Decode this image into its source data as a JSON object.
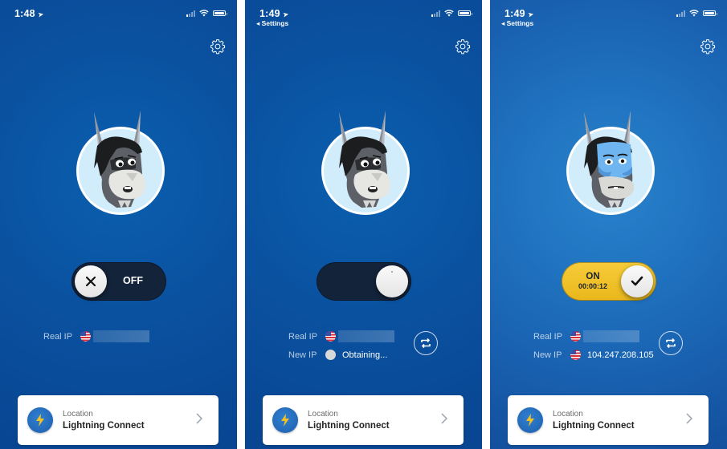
{
  "colors": {
    "background_disconnected": "#0a52a0",
    "background_connected": "#1f72bf",
    "toggle_off": "#13233a",
    "toggle_on": "#f0c22a",
    "avatar_circle": "#d1ecfb",
    "location_icon_bg": "#1f5fae",
    "bolt": "#f5c020"
  },
  "screens": [
    {
      "state": "disconnected",
      "status_bar": {
        "time": "1:48",
        "back_label": null
      },
      "settings_icon": "gear-icon",
      "avatar": "donkey-worried",
      "toggle": {
        "state": "off",
        "label": "OFF",
        "knob_icon": "close-icon"
      },
      "ip": {
        "real_ip_label": "Real IP",
        "real_ip_flag": "us-flag-icon",
        "real_ip_value": "(redacted)"
      },
      "location": {
        "label": "Location",
        "value": "Lightning Connect",
        "icon": "lightning-icon"
      }
    },
    {
      "state": "connecting",
      "status_bar": {
        "time": "1:49",
        "back_label": "Settings"
      },
      "settings_icon": "gear-icon",
      "avatar": "donkey-worried",
      "toggle": {
        "state": "connecting",
        "label": "",
        "knob_icon": "spinner-icon"
      },
      "ip": {
        "real_ip_label": "Real IP",
        "real_ip_flag": "us-flag-icon",
        "real_ip_value": "(redacted)",
        "new_ip_label": "New IP",
        "new_ip_flag": "unknown-flag-icon",
        "new_ip_value": "Obtaining..."
      },
      "refresh_icon": "change-ip-icon",
      "location": {
        "label": "Location",
        "value": "Lightning Connect",
        "icon": "lightning-icon"
      }
    },
    {
      "state": "connected",
      "status_bar": {
        "time": "1:49",
        "back_label": "Settings"
      },
      "settings_icon": "gear-icon",
      "avatar": "donkey-masked",
      "toggle": {
        "state": "on",
        "label": "ON",
        "timer": "00:00:12",
        "knob_icon": "check-icon"
      },
      "ip": {
        "real_ip_label": "Real IP",
        "real_ip_flag": "us-flag-icon",
        "real_ip_value": "(redacted)",
        "new_ip_label": "New IP",
        "new_ip_flag": "us-flag-icon",
        "new_ip_value": "104.247.208.105"
      },
      "refresh_icon": "change-ip-icon",
      "location": {
        "label": "Location",
        "value": "Lightning Connect",
        "icon": "lightning-icon"
      }
    }
  ]
}
